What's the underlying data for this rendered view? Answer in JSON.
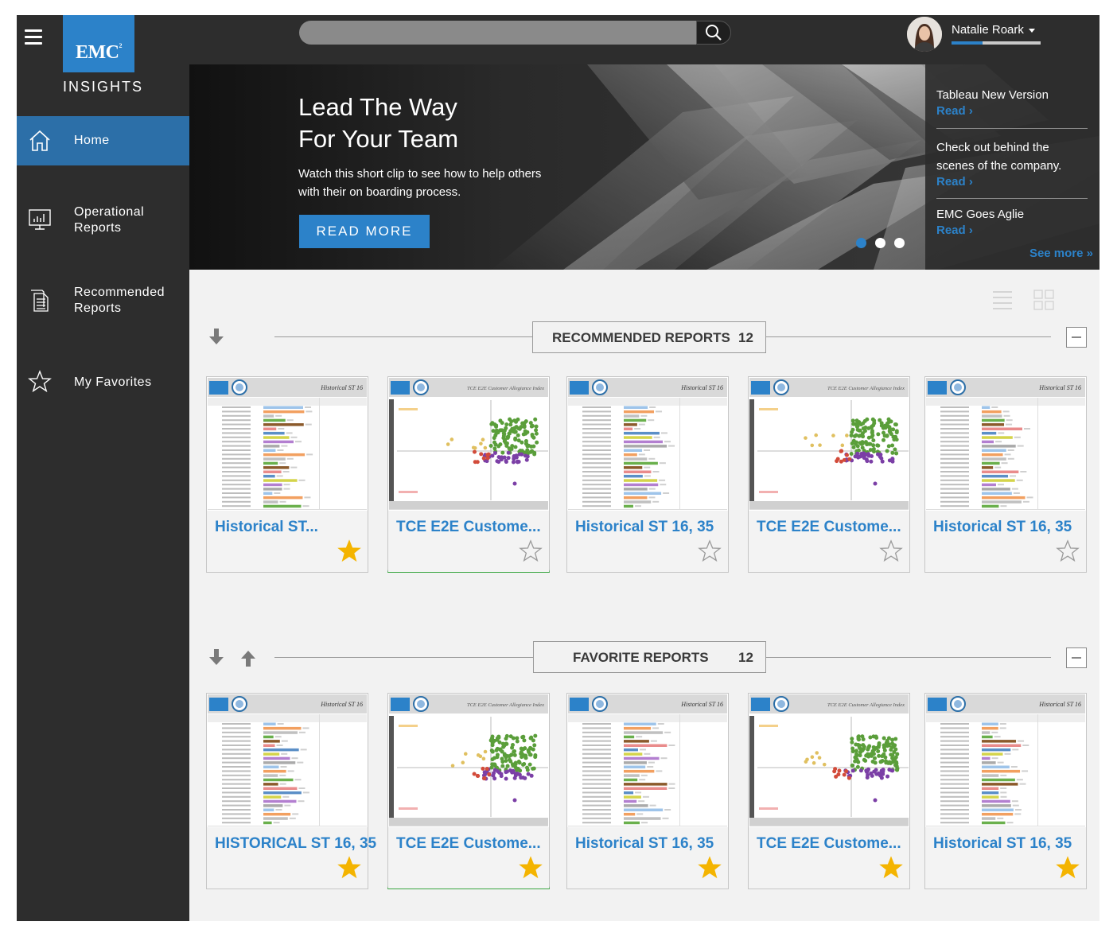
{
  "brand": {
    "logo": "EMC",
    "logo_sup": "2",
    "product": "INSIGHTS"
  },
  "sidebar": {
    "items": [
      {
        "label": "Home",
        "icon": "home-icon",
        "active": true
      },
      {
        "label": "Operational Reports",
        "icon": "monitor-chart-icon"
      },
      {
        "label": "Recommended Reports",
        "icon": "documents-icon"
      },
      {
        "label": "My Favorites",
        "icon": "star-outline-icon"
      }
    ]
  },
  "topbar": {
    "search": {
      "value": "",
      "placeholder": ""
    },
    "user": {
      "name": "Natalie Roark",
      "progress": 0.35
    }
  },
  "hero": {
    "title_line1": "Lead The Way",
    "title_line2": "For Your Team",
    "subtitle": "Watch this short clip to see how to help others with their on boarding process.",
    "button": "READ MORE",
    "active_slide": 0,
    "slides": 3
  },
  "news": {
    "items": [
      {
        "title": "Tableau New Version",
        "link": "Read ›"
      },
      {
        "title": "Check out behind the scenes of the company.",
        "link": "Read ›"
      },
      {
        "title": "EMC Goes Aglie",
        "link": "Read ›"
      }
    ],
    "see_more": "See more »"
  },
  "sections": [
    {
      "title": "RECOMMENDED REPORTS",
      "count": "12",
      "cards": [
        {
          "title": "Historical ST...",
          "thumb": "bar-report",
          "favorite": true,
          "highlight": false
        },
        {
          "title": "TCE E2E Custome...",
          "thumb": "scatter-report",
          "favorite": false,
          "highlight": true
        },
        {
          "title": "Historical ST 16, 35",
          "thumb": "bar-report",
          "favorite": false,
          "highlight": false
        },
        {
          "title": "TCE E2E Custome...",
          "thumb": "scatter-report",
          "favorite": false,
          "highlight": false
        },
        {
          "title": "Historical ST 16, 35",
          "thumb": "bar-report",
          "favorite": false,
          "highlight": false
        }
      ]
    },
    {
      "title": "FAVORITE REPORTS",
      "count": "12",
      "cards": [
        {
          "title": "HISTORICAL ST 16, 35",
          "thumb": "bar-report",
          "favorite": true,
          "highlight": false
        },
        {
          "title": "TCE E2E Custome...",
          "thumb": "scatter-report",
          "favorite": true,
          "highlight": true
        },
        {
          "title": "Historical ST 16, 35",
          "thumb": "bar-report",
          "favorite": true,
          "highlight": false
        },
        {
          "title": "TCE E2E Custome...",
          "thumb": "scatter-report",
          "favorite": true,
          "highlight": false
        },
        {
          "title": "Historical ST 16, 35",
          "thumb": "bar-report",
          "favorite": true,
          "highlight": false
        }
      ]
    }
  ],
  "thumbnails": {
    "bar_header": "Historical ST 16",
    "scatter_header": "TCE E2E Customer Allegiance Index"
  },
  "colors": {
    "accent": "#2c82c9",
    "sidebar": "#2d2d2d",
    "star_filled": "#f4b400",
    "highlight": "#3aa642"
  }
}
